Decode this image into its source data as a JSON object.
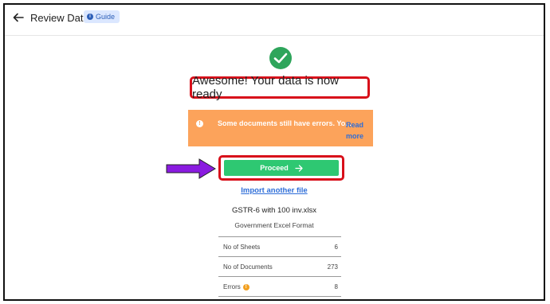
{
  "header": {
    "title": "Review Data",
    "guide_label": "Guide",
    "guide_icon": "info-icon"
  },
  "status": {
    "icon": "checkmark-circle-icon",
    "icon_color": "#2ea55b",
    "heading": "Awesome! Your data is now ready"
  },
  "warning": {
    "icon": "exclamation-icon",
    "text": "Some documents still have errors. Yo...",
    "read_more": "Read more",
    "background": "#fca35b"
  },
  "actions": {
    "proceed_label": "Proceed",
    "proceed_icon": "arrow-right-icon",
    "import_label": "Import another file"
  },
  "file": {
    "name": "GSTR-6 with 100 inv.xlsx",
    "format": "Government Excel Format"
  },
  "stats": [
    {
      "label": "No of Sheets",
      "value": "6"
    },
    {
      "label": "No of Documents",
      "value": "273"
    },
    {
      "label": "Errors",
      "value": "8"
    }
  ],
  "colors": {
    "highlight": "#d80f1a",
    "proceed_bg": "#2ec872",
    "link": "#2d6dd8",
    "annotation_arrow": "#8a1be0"
  }
}
